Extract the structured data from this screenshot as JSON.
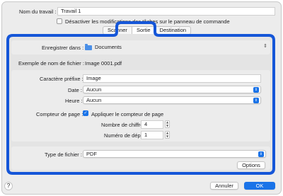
{
  "job": {
    "name_label": "Nom du travail :",
    "name_value": "Travail 1",
    "disable_checkbox_label": "Désactiver les modifications des tâches sur le panneau de commande"
  },
  "tabs": [
    "Scanner",
    "Sortie",
    "Destination"
  ],
  "output": {
    "save_in_label": "Enregistrer dans :",
    "save_in_value": "Documents",
    "filename_example_label": "Exemple de nom de fichier :",
    "filename_example_value": "Image 0001.pdf",
    "prefix_label": "Caractère préfixe :",
    "prefix_value": "Image",
    "date_label": "Date :",
    "date_value": "Aucun",
    "time_label": "Heure :",
    "time_value": "Aucun",
    "counter_label": "Compteur de page :",
    "counter_checkbox_label": "Appliquer le compteur de page",
    "digits_label": "Nombre de chiffres :",
    "digits_value": "4",
    "start_label": "Numéro de départ :",
    "start_value": "1",
    "filetype_label": "Type de fichier :",
    "filetype_value": "PDF",
    "options_button": "Options"
  },
  "footer": {
    "help": "?",
    "cancel_button": "Annuler",
    "ok_button": "OK"
  },
  "colors": {
    "accent": "#1a73e8",
    "highlight": "#1556d8"
  }
}
